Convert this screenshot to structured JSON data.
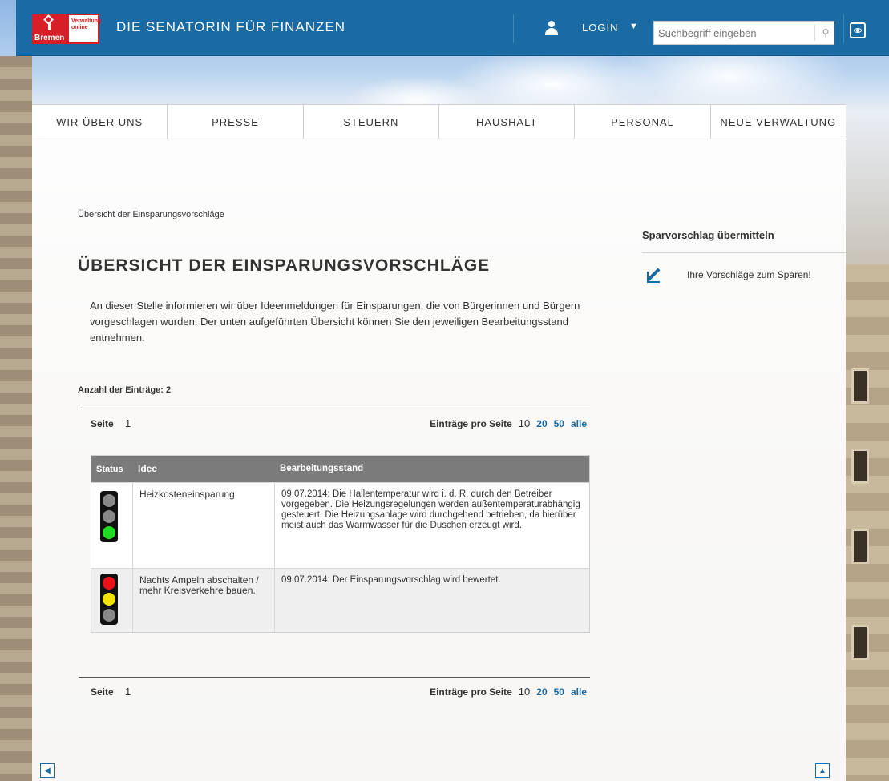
{
  "header": {
    "site_title": "DIE SENATORIN FÜR FINANZEN",
    "logo_name": "Bremen",
    "logo_subtitle_1": "Verwaltung",
    "logo_subtitle_2": "online",
    "login_label": "LOGIN",
    "search_placeholder": "Suchbegriff eingeben",
    "colors": {
      "bar": "#1a6aa3",
      "logo_red": "#d61f26"
    }
  },
  "nav": {
    "items": [
      "WIR ÜBER UNS",
      "PRESSE",
      "STEUERN",
      "HAUSHALT",
      "PERSONAL",
      "NEUE VERWALTUNG"
    ]
  },
  "main": {
    "breadcrumb": "Übersicht der Einsparungsvorschläge",
    "title": "ÜBERSICHT DER EINSPARUNGSVORSCHLÄGE",
    "intro": "An dieser Stelle informieren wir über Ideenmeldungen für Einsparungen, die von Bürgerinnen und Bürgern vorgeschlagen wurden. Der unten aufgeführten Übersicht können Sie den jeweiligen Bearbeitungsstand entnehmen.",
    "count_label": "Anzahl der Einträge: 2",
    "pager": {
      "page_label": "Seite",
      "page_number": "1",
      "per_page_label": "Einträge pro Seite",
      "per_page_current": "10",
      "per_page_options": [
        "20",
        "50",
        "alle"
      ]
    },
    "table": {
      "headers": [
        "Status",
        "Idee",
        "Bearbeitungsstand"
      ],
      "rows": [
        {
          "status": "green",
          "idea": "Heizkosteneinsparung",
          "progress": "09.07.2014: Die Hallentemperatur wird i. d. R. durch den Betreiber vorgegeben. Die Heizungsregelungen werden außentemperaturabhängig gesteuert. Die Heizungsanlage wird durchgehend betrieben, da hierüber meist auch das Warmwasser für die Duschen erzeugt wird."
        },
        {
          "status": "red-yellow",
          "idea": "Nachts Ampeln abschalten / mehr Kreisverkehre bauen.",
          "progress": "09.07.2014: Der Einsparungsvorschlag wird bewertet."
        }
      ]
    }
  },
  "sidebar": {
    "title": "Sparvorschlag übermitteln",
    "link_label": "Ihre Vorschläge zum Sparen!"
  },
  "icons": [
    "user-icon",
    "caret-down-icon",
    "search-icon",
    "eye-icon",
    "pen-icon",
    "arrow-left-icon",
    "arrow-up-icon"
  ],
  "status_colors": {
    "red": "#e8111a",
    "yellow": "#f3e300",
    "green": "#22dc22",
    "off": "#888888"
  }
}
